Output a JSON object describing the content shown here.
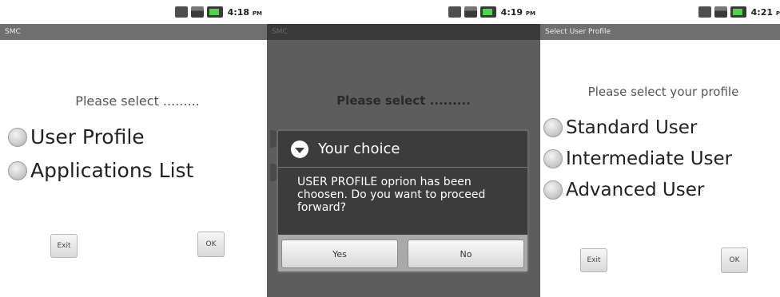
{
  "screen1": {
    "status_time": "4:18",
    "status_ampm": "PM",
    "app_title": "SMC",
    "prompt": "Please select .........",
    "options": [
      "User Profile",
      "Applications List"
    ],
    "exit_label": "Exit",
    "ok_label": "OK"
  },
  "screen2": {
    "status_time": "4:19",
    "status_ampm": "PM",
    "app_title": "SMC",
    "prompt": "Please select .........",
    "dialog": {
      "title": "Your choice",
      "message": "USER PROFILE oprion has been choosen. Do you want to proceed forward?",
      "yes_label": "Yes",
      "no_label": "No"
    }
  },
  "screen3": {
    "status_time": "4:21",
    "status_ampm": "P",
    "app_title": "Select User Profile",
    "prompt": "Please select your profile",
    "options": [
      "Standard User",
      "Intermediate User",
      "Advanced User"
    ],
    "exit_label": "Exit",
    "ok_label": "OK"
  },
  "colors": {
    "dim_overlay": "#5d5d5d",
    "dialog_bg": "#3c3c3c",
    "titlebar": "#6f6f6f"
  }
}
